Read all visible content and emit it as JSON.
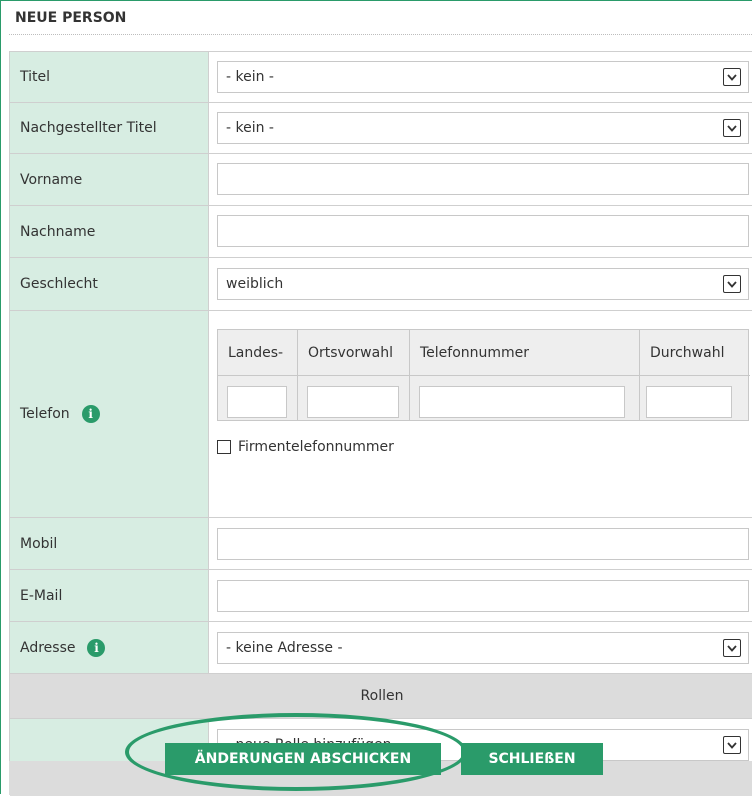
{
  "dialog": {
    "title": "NEUE PERSON"
  },
  "fields": {
    "titel": {
      "label": "Titel",
      "value": "- kein -"
    },
    "nachgestellter_titel": {
      "label": "Nachgestellter Titel",
      "value": "- kein -"
    },
    "vorname": {
      "label": "Vorname",
      "value": ""
    },
    "nachname": {
      "label": "Nachname",
      "value": ""
    },
    "geschlecht": {
      "label": "Geschlecht",
      "value": "weiblich"
    },
    "telefon": {
      "label": "Telefon",
      "columns": [
        "Landes-",
        "Ortsvorwahl",
        "Telefonnummer",
        "Durchwahl"
      ],
      "company_checkbox_label": "Firmentelefonnummer",
      "company_checkbox_checked": false
    },
    "mobil": {
      "label": "Mobil",
      "value": ""
    },
    "email": {
      "label": "E-Mail",
      "value": ""
    },
    "adresse": {
      "label": "Adresse",
      "value": "- keine Adresse -"
    }
  },
  "rollen": {
    "header": "Rollen",
    "select_value": "- neue Rolle hinzufügen -"
  },
  "buttons": {
    "submit": "ÄNDERUNGEN ABSCHICKEN",
    "close": "SCHLIEßEN"
  },
  "icons": {
    "info": "info-icon",
    "dropdown": "chevron-down-icon"
  },
  "colors": {
    "accent": "#2a9b6a",
    "label_bg": "#d7ede2",
    "section_bg": "#dcdcdc"
  }
}
